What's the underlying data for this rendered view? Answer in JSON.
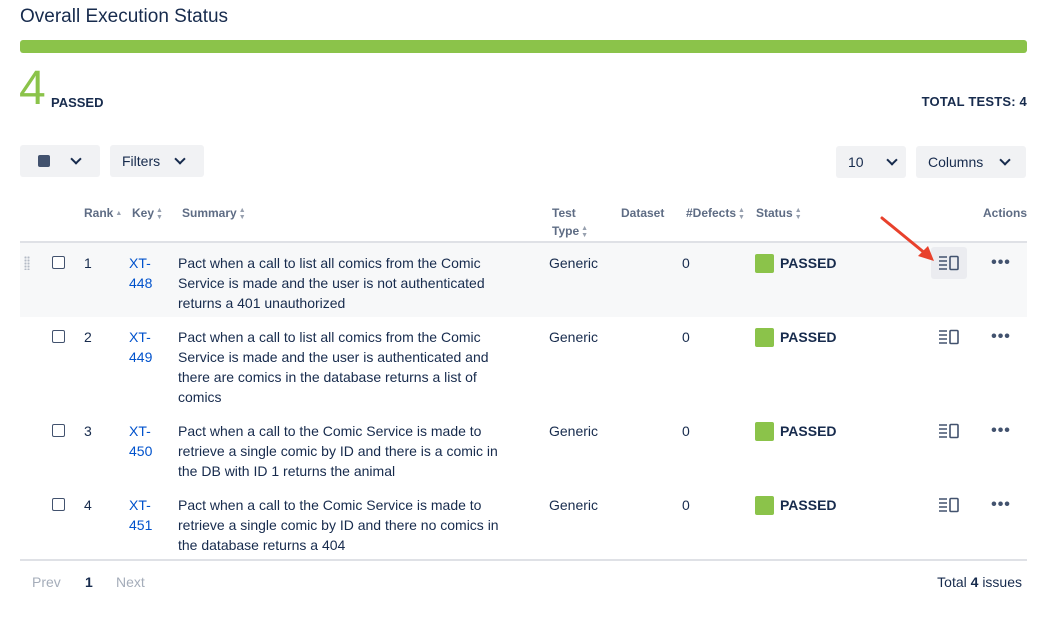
{
  "header": {
    "title": "Overall Execution Status",
    "passed_count": "4",
    "passed_label": "PASSED",
    "total_tests": "TOTAL TESTS: 4"
  },
  "progress": {
    "passed_fraction": 1.0,
    "color": "#8bc34a"
  },
  "toolbar": {
    "filters_label": "Filters",
    "page_size": "10",
    "columns_label": "Columns"
  },
  "table": {
    "columns": {
      "rank": "Rank",
      "key": "Key",
      "summary": "Summary",
      "test_type_1": "Test",
      "test_type_2": "Type",
      "dataset": "Dataset",
      "defects": "#Defects",
      "status": "Status",
      "actions": "Actions"
    },
    "rows": [
      {
        "rank": "1",
        "key_1": "XT-",
        "key_2": "448",
        "summary_1": "Pact when a call to list all comics from the Comic",
        "summary_2": "Service is made and the user is not authenticated",
        "summary_3": "returns a 401 unauthorized",
        "summary_4": "",
        "test_type": "Generic",
        "defects": "0",
        "status": "PASSED"
      },
      {
        "rank": "2",
        "key_1": "XT-",
        "key_2": "449",
        "summary_1": "Pact when a call to list all comics from the Comic",
        "summary_2": "Service is made and the user is authenticated and",
        "summary_3": "there are comics in the database returns a list of",
        "summary_4": "comics",
        "test_type": "Generic",
        "defects": "0",
        "status": "PASSED"
      },
      {
        "rank": "3",
        "key_1": "XT-",
        "key_2": "450",
        "summary_1": "Pact when a call to the Comic Service is made to",
        "summary_2": "retrieve a single comic by ID and there is a comic in",
        "summary_3": "the DB with ID 1 returns the animal",
        "summary_4": "",
        "test_type": "Generic",
        "defects": "0",
        "status": "PASSED"
      },
      {
        "rank": "4",
        "key_1": "XT-",
        "key_2": "451",
        "summary_1": "Pact when a call to the Comic Service is made to",
        "summary_2": "retrieve a single comic by ID and there no comics in",
        "summary_3": "the database returns a 404",
        "summary_4": "",
        "test_type": "Generic",
        "defects": "0",
        "status": "PASSED"
      }
    ]
  },
  "pagination": {
    "prev": "Prev",
    "current": "1",
    "next": "Next",
    "total_prefix": "Total",
    "total_count": "4",
    "total_suffix": "issues"
  },
  "colors": {
    "accent": "#8bc34a",
    "link": "#0052cc",
    "annotation_arrow": "#e8412c"
  }
}
